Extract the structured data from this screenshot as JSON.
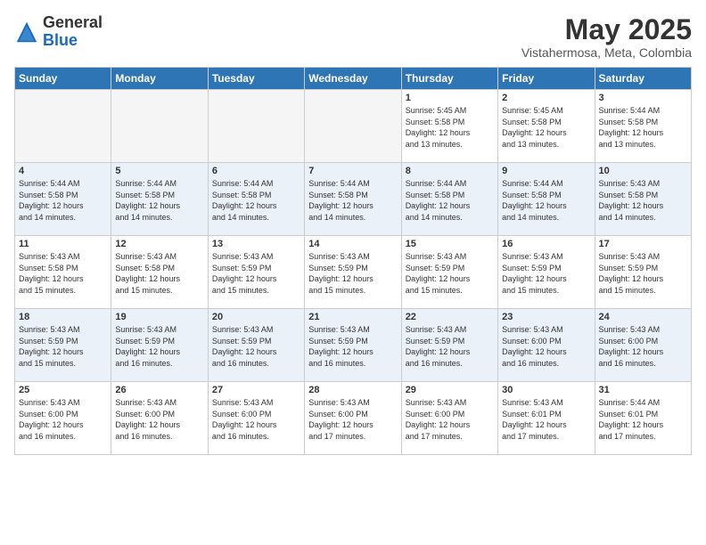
{
  "header": {
    "logo_general": "General",
    "logo_blue": "Blue",
    "month_title": "May 2025",
    "location": "Vistahermosa, Meta, Colombia"
  },
  "weekdays": [
    "Sunday",
    "Monday",
    "Tuesday",
    "Wednesday",
    "Thursday",
    "Friday",
    "Saturday"
  ],
  "weeks": [
    [
      {
        "day": "",
        "info": ""
      },
      {
        "day": "",
        "info": ""
      },
      {
        "day": "",
        "info": ""
      },
      {
        "day": "",
        "info": ""
      },
      {
        "day": "1",
        "info": "Sunrise: 5:45 AM\nSunset: 5:58 PM\nDaylight: 12 hours\nand 13 minutes."
      },
      {
        "day": "2",
        "info": "Sunrise: 5:45 AM\nSunset: 5:58 PM\nDaylight: 12 hours\nand 13 minutes."
      },
      {
        "day": "3",
        "info": "Sunrise: 5:44 AM\nSunset: 5:58 PM\nDaylight: 12 hours\nand 13 minutes."
      }
    ],
    [
      {
        "day": "4",
        "info": "Sunrise: 5:44 AM\nSunset: 5:58 PM\nDaylight: 12 hours\nand 14 minutes."
      },
      {
        "day": "5",
        "info": "Sunrise: 5:44 AM\nSunset: 5:58 PM\nDaylight: 12 hours\nand 14 minutes."
      },
      {
        "day": "6",
        "info": "Sunrise: 5:44 AM\nSunset: 5:58 PM\nDaylight: 12 hours\nand 14 minutes."
      },
      {
        "day": "7",
        "info": "Sunrise: 5:44 AM\nSunset: 5:58 PM\nDaylight: 12 hours\nand 14 minutes."
      },
      {
        "day": "8",
        "info": "Sunrise: 5:44 AM\nSunset: 5:58 PM\nDaylight: 12 hours\nand 14 minutes."
      },
      {
        "day": "9",
        "info": "Sunrise: 5:44 AM\nSunset: 5:58 PM\nDaylight: 12 hours\nand 14 minutes."
      },
      {
        "day": "10",
        "info": "Sunrise: 5:43 AM\nSunset: 5:58 PM\nDaylight: 12 hours\nand 14 minutes."
      }
    ],
    [
      {
        "day": "11",
        "info": "Sunrise: 5:43 AM\nSunset: 5:58 PM\nDaylight: 12 hours\nand 15 minutes."
      },
      {
        "day": "12",
        "info": "Sunrise: 5:43 AM\nSunset: 5:58 PM\nDaylight: 12 hours\nand 15 minutes."
      },
      {
        "day": "13",
        "info": "Sunrise: 5:43 AM\nSunset: 5:59 PM\nDaylight: 12 hours\nand 15 minutes."
      },
      {
        "day": "14",
        "info": "Sunrise: 5:43 AM\nSunset: 5:59 PM\nDaylight: 12 hours\nand 15 minutes."
      },
      {
        "day": "15",
        "info": "Sunrise: 5:43 AM\nSunset: 5:59 PM\nDaylight: 12 hours\nand 15 minutes."
      },
      {
        "day": "16",
        "info": "Sunrise: 5:43 AM\nSunset: 5:59 PM\nDaylight: 12 hours\nand 15 minutes."
      },
      {
        "day": "17",
        "info": "Sunrise: 5:43 AM\nSunset: 5:59 PM\nDaylight: 12 hours\nand 15 minutes."
      }
    ],
    [
      {
        "day": "18",
        "info": "Sunrise: 5:43 AM\nSunset: 5:59 PM\nDaylight: 12 hours\nand 15 minutes."
      },
      {
        "day": "19",
        "info": "Sunrise: 5:43 AM\nSunset: 5:59 PM\nDaylight: 12 hours\nand 16 minutes."
      },
      {
        "day": "20",
        "info": "Sunrise: 5:43 AM\nSunset: 5:59 PM\nDaylight: 12 hours\nand 16 minutes."
      },
      {
        "day": "21",
        "info": "Sunrise: 5:43 AM\nSunset: 5:59 PM\nDaylight: 12 hours\nand 16 minutes."
      },
      {
        "day": "22",
        "info": "Sunrise: 5:43 AM\nSunset: 5:59 PM\nDaylight: 12 hours\nand 16 minutes."
      },
      {
        "day": "23",
        "info": "Sunrise: 5:43 AM\nSunset: 6:00 PM\nDaylight: 12 hours\nand 16 minutes."
      },
      {
        "day": "24",
        "info": "Sunrise: 5:43 AM\nSunset: 6:00 PM\nDaylight: 12 hours\nand 16 minutes."
      }
    ],
    [
      {
        "day": "25",
        "info": "Sunrise: 5:43 AM\nSunset: 6:00 PM\nDaylight: 12 hours\nand 16 minutes."
      },
      {
        "day": "26",
        "info": "Sunrise: 5:43 AM\nSunset: 6:00 PM\nDaylight: 12 hours\nand 16 minutes."
      },
      {
        "day": "27",
        "info": "Sunrise: 5:43 AM\nSunset: 6:00 PM\nDaylight: 12 hours\nand 16 minutes."
      },
      {
        "day": "28",
        "info": "Sunrise: 5:43 AM\nSunset: 6:00 PM\nDaylight: 12 hours\nand 17 minutes."
      },
      {
        "day": "29",
        "info": "Sunrise: 5:43 AM\nSunset: 6:00 PM\nDaylight: 12 hours\nand 17 minutes."
      },
      {
        "day": "30",
        "info": "Sunrise: 5:43 AM\nSunset: 6:01 PM\nDaylight: 12 hours\nand 17 minutes."
      },
      {
        "day": "31",
        "info": "Sunrise: 5:44 AM\nSunset: 6:01 PM\nDaylight: 12 hours\nand 17 minutes."
      }
    ]
  ]
}
